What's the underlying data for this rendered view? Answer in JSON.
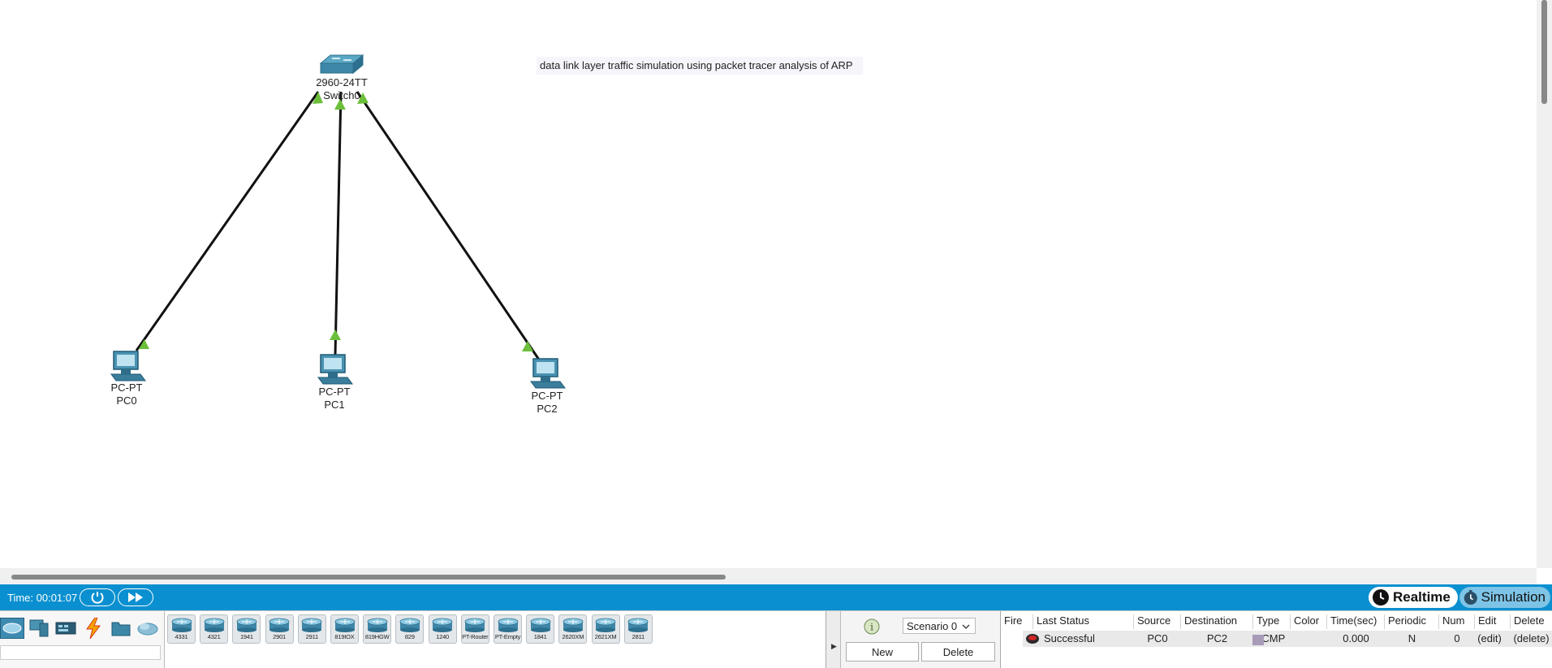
{
  "workspace": {
    "note": "data link layer traffic simulation using packet tracer analysis of ARP",
    "devices": [
      {
        "model": "2960-24TT",
        "name": "Switch0"
      },
      {
        "model": "PC-PT",
        "name": "PC0"
      },
      {
        "model": "PC-PT",
        "name": "PC1"
      },
      {
        "model": "PC-PT",
        "name": "PC2"
      }
    ],
    "link_color": "#111111",
    "port_up_color": "#6bbf3a"
  },
  "timebar": {
    "time_text": "Time: 00:01:07",
    "reset_icon": "power-cycle-icon",
    "fast_forward_icon": "fast-forward-icon",
    "realtime_label": "Realtime",
    "simulation_label": "Simulation",
    "bar_color": "#0a90d0"
  },
  "device_categories": [
    "network-devices-icon",
    "end-devices-icon",
    "components-icon",
    "connections-icon",
    "miscellaneous-icon",
    "multiuser-icon"
  ],
  "router_models": [
    "4331",
    "4321",
    "1941",
    "2901",
    "2911",
    "819IOX",
    "819HGW",
    "829",
    "1240",
    "PT-Router",
    "PT-Empty",
    "1841",
    "2620XM",
    "2621XM",
    "2811"
  ],
  "scenario": {
    "selected": "Scenario 0",
    "new_label": "New",
    "delete_label": "Delete"
  },
  "pdu_table": {
    "headers": [
      "Fire",
      "Last Status",
      "Source",
      "Destination",
      "Type",
      "Color",
      "Time(sec)",
      "Periodic",
      "Num",
      "Edit",
      "Delete"
    ],
    "rows": [
      {
        "status": "Successful",
        "source": "PC0",
        "destination": "PC2",
        "type": "ICMP",
        "color": "#a89bb8",
        "time": "0.000",
        "periodic": "N",
        "num": "0",
        "edit": "(edit)",
        "delete": "(delete)"
      }
    ]
  }
}
